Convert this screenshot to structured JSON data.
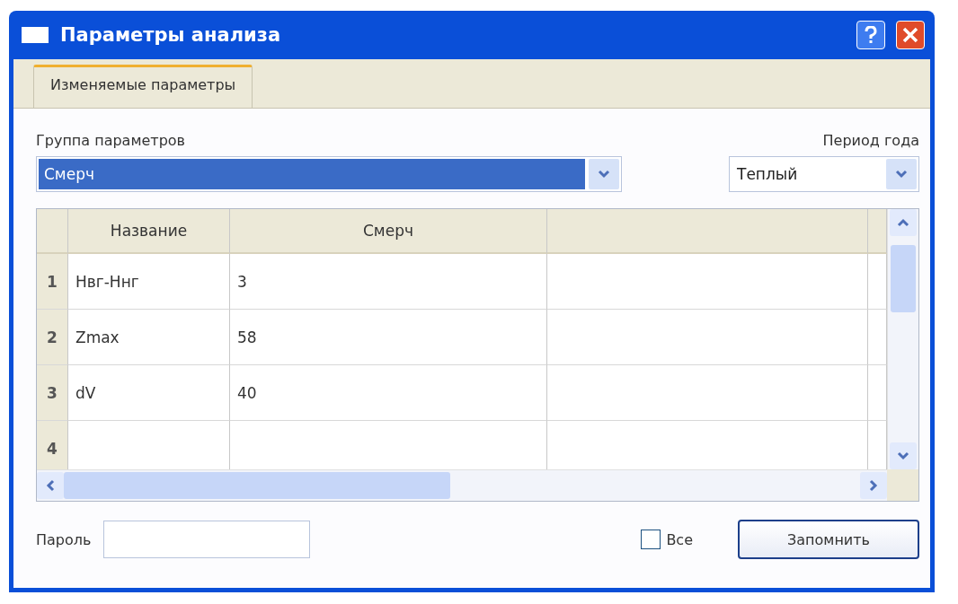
{
  "window": {
    "title": "Параметры анализа"
  },
  "tabs": [
    {
      "label": "Изменяемые параметры",
      "selected": true
    }
  ],
  "group": {
    "label": "Группа параметров",
    "value": "Смерч",
    "highlighted": true
  },
  "period": {
    "label": "Период года",
    "value": "Теплый"
  },
  "table": {
    "columns": [
      "Название",
      "Смерч"
    ],
    "rows": [
      {
        "number": "1",
        "cells": [
          "Hвг-Hнг",
          "3"
        ]
      },
      {
        "number": "2",
        "cells": [
          "Zmax",
          "58"
        ]
      },
      {
        "number": "3",
        "cells": [
          "dV",
          "40"
        ]
      },
      {
        "number": "4",
        "cells": []
      }
    ]
  },
  "password": {
    "label": "Пароль"
  },
  "all_checkbox": {
    "label": "Все",
    "checked": false
  },
  "buttons": [
    {
      "label": "Запомнить"
    }
  ]
}
